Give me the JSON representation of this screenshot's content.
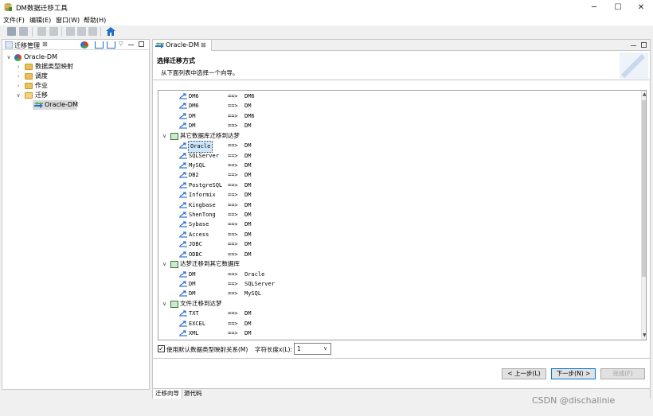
{
  "window": {
    "title": "DM数据迁移工具",
    "minimize": "─",
    "maximize": "☐",
    "close": "✕"
  },
  "menu": [
    {
      "label": "文件(F)"
    },
    {
      "label": "编辑(E)"
    },
    {
      "label": "窗口(W)"
    },
    {
      "label": "帮助(H)"
    }
  ],
  "toolbar": {
    "icons": [
      "save-icon",
      "save-all-icon",
      "back-icon",
      "forward-icon",
      "cut-icon",
      "copy-icon",
      "paste-icon",
      "home-icon"
    ]
  },
  "left_panel": {
    "tab_label": "迁移管理",
    "tab_close": "⊠",
    "tree": [
      {
        "label": "Oracle-DM",
        "level": 0,
        "expanded": true,
        "icon": "project-icon"
      },
      {
        "label": "数据类型映射",
        "level": 1,
        "expanded": false,
        "icon": "folder-icon"
      },
      {
        "label": "调度",
        "level": 1,
        "expanded": false,
        "icon": "folder-icon"
      },
      {
        "label": "作业",
        "level": 1,
        "expanded": false,
        "icon": "folder-icon"
      },
      {
        "label": "迁移",
        "level": 1,
        "expanded": true,
        "icon": "folder-open-icon"
      },
      {
        "label": "Oracle-DM",
        "level": 2,
        "expanded": null,
        "icon": "migration-icon",
        "selected": true
      }
    ]
  },
  "editor": {
    "tab_label": "Oracle-DM",
    "tab_close": "⊠",
    "wizard_title": "选择迁移方式",
    "wizard_description": "从下面列表中选择一个向导。",
    "list": [
      {
        "type": "leaf",
        "src": "DM6",
        "arrow": "==>",
        "dst": "DM6"
      },
      {
        "type": "leaf",
        "src": "DM6",
        "arrow": "==>",
        "dst": "DM"
      },
      {
        "type": "leaf",
        "src": "DM",
        "arrow": "==>",
        "dst": "DM6"
      },
      {
        "type": "leaf",
        "src": "DM",
        "arrow": "==>",
        "dst": "DM"
      },
      {
        "type": "group",
        "label": "其它数据库迁移到达梦"
      },
      {
        "type": "leaf",
        "src": "Oracle",
        "arrow": "==>",
        "dst": "DM",
        "selected": true
      },
      {
        "type": "leaf",
        "src": "SQLServer",
        "arrow": "==>",
        "dst": "DM"
      },
      {
        "type": "leaf",
        "src": "MySQL",
        "arrow": "==>",
        "dst": "DM"
      },
      {
        "type": "leaf",
        "src": "DB2",
        "arrow": "==>",
        "dst": "DM"
      },
      {
        "type": "leaf",
        "src": "PostgreSQL",
        "arrow": "==>",
        "dst": "DM"
      },
      {
        "type": "leaf",
        "src": "Informix",
        "arrow": "==>",
        "dst": "DM"
      },
      {
        "type": "leaf",
        "src": "Kingbase",
        "arrow": "==>",
        "dst": "DM"
      },
      {
        "type": "leaf",
        "src": "ShenTong",
        "arrow": "==>",
        "dst": "DM"
      },
      {
        "type": "leaf",
        "src": "Sybase",
        "arrow": "==>",
        "dst": "DM"
      },
      {
        "type": "leaf",
        "src": "Access",
        "arrow": "==>",
        "dst": "DM"
      },
      {
        "type": "leaf",
        "src": "JDBC",
        "arrow": "==>",
        "dst": "DM"
      },
      {
        "type": "leaf",
        "src": "ODBC",
        "arrow": "==>",
        "dst": "DM"
      },
      {
        "type": "group",
        "label": "达梦迁移到其它数据库"
      },
      {
        "type": "leaf",
        "src": "DM",
        "arrow": "==>",
        "dst": "Oracle"
      },
      {
        "type": "leaf",
        "src": "DM",
        "arrow": "==>",
        "dst": "SQLServer"
      },
      {
        "type": "leaf",
        "src": "DM",
        "arrow": "==>",
        "dst": "MySQL"
      },
      {
        "type": "group",
        "label": "文件迁移到达梦"
      },
      {
        "type": "leaf",
        "src": "TXT",
        "arrow": "==>",
        "dst": "DM"
      },
      {
        "type": "leaf",
        "src": "EXCEL",
        "arrow": "==>",
        "dst": "DM"
      },
      {
        "type": "leaf",
        "src": "XML",
        "arrow": "==>",
        "dst": "DM"
      }
    ],
    "use_default_mapping_label": "使用默认数据类型映射关系(M)",
    "use_default_mapping_checked": true,
    "char_length_label": "字符长度x(L):",
    "char_length_value": "1",
    "prev_button": "< 上一步(L)",
    "next_button": "下一步(N) >",
    "finish_button": "完成(F)",
    "bottom_tabs": [
      "迁移向导",
      "源代码"
    ]
  },
  "watermark": "CSDN @dischalinie",
  "colors": {
    "selection": "#cce8ff",
    "folder": "#e8c15a",
    "accent_blue": "#1e6fc5"
  }
}
